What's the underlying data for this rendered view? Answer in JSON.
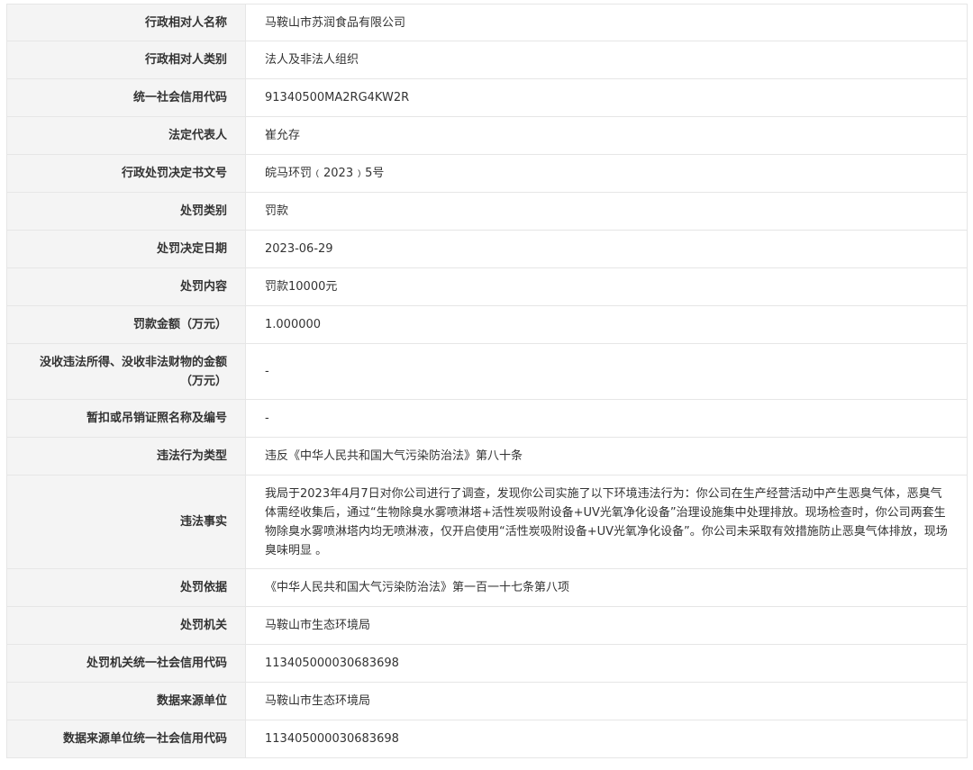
{
  "rows": [
    {
      "label": "行政相对人名称",
      "value": "马鞍山市苏润食品有限公司"
    },
    {
      "label": "行政相对人类别",
      "value": "法人及非法人组织"
    },
    {
      "label": "统一社会信用代码",
      "value": "91340500MA2RG4KW2R"
    },
    {
      "label": "法定代表人",
      "value": "崔允存"
    },
    {
      "label": "行政处罚决定书文号",
      "value": "皖马环罚﹙2023﹚5号"
    },
    {
      "label": "处罚类别",
      "value": "罚款"
    },
    {
      "label": "处罚决定日期",
      "value": "2023-06-29"
    },
    {
      "label": "处罚内容",
      "value": "罚款10000元"
    },
    {
      "label": "罚款金额（万元）",
      "value": "1.000000"
    },
    {
      "label": "没收违法所得、没收非法财物的金额（万元）",
      "value": "-"
    },
    {
      "label": "暂扣或吊销证照名称及编号",
      "value": "-"
    },
    {
      "label": "违法行为类型",
      "value": "违反《中华人民共和国大气污染防治法》第八十条"
    },
    {
      "label": "违法事实",
      "value": "我局于2023年4月7日对你公司进行了调查，发现你公司实施了以下环境违法行为：你公司在生产经营活动中产生恶臭气体，恶臭气体需经收集后，通过“生物除臭水雾喷淋塔+活性炭吸附设备+UV光氧净化设备”治理设施集中处理排放。现场检查时，你公司两套生物除臭水雾喷淋塔内均无喷淋液，仅开启使用“活性炭吸附设备+UV光氧净化设备”。你公司未采取有效措施防止恶臭气体排放，现场臭味明显 。"
    },
    {
      "label": "处罚依据",
      "value": "《中华人民共和国大气污染防治法》第一百一十七条第八项"
    },
    {
      "label": "处罚机关",
      "value": "马鞍山市生态环境局"
    },
    {
      "label": "处罚机关统一社会信用代码",
      "value": "11340500003068369​8"
    },
    {
      "label": "数据来源单位",
      "value": "马鞍山市生态环境局"
    },
    {
      "label": "数据来源单位统一社会信用代码",
      "value": "113405000030683698"
    }
  ]
}
